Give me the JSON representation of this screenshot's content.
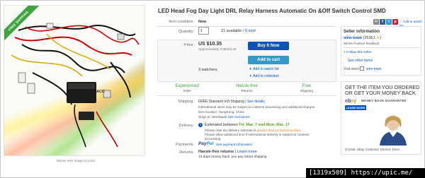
{
  "product": {
    "title": "LED Head Fog Day Light DRL Relay Harness Automatic On &Off Switch Control SMD",
    "image_ribbon": "FREE SHIPPING",
    "image_label": "ACC",
    "image_caption": "Mouse over image to zoom"
  },
  "meta": {
    "condition_label": "Item condition:",
    "condition_value": "New",
    "quantity_label": "Quantity:",
    "quantity_value": "1",
    "available_text": "21 available / ",
    "sold_text": "6 sold"
  },
  "share": {
    "icons": [
      "email-icon",
      "facebook-icon",
      "twitter-icon",
      "pinterest-icon"
    ],
    "watch_link": "Add to watch list"
  },
  "price": {
    "label": "Price:",
    "value": "US $10.35",
    "approx": "Approximately THB334.46",
    "buy_label": "Buy It Now",
    "cart_label": "Add to cart",
    "watchers": "3 watchers",
    "add_watch": "Add to watch list",
    "add_collection": "Add to collection"
  },
  "badges": [
    {
      "title": "Experienced",
      "sub": "Seller"
    },
    {
      "title": "Hassle-free",
      "sub": "Returns"
    },
    {
      "title": "Free",
      "sub": "Shipping"
    }
  ],
  "shipping": {
    "label": "Shipping:",
    "line1_main": "FREE  Standard Int'l Shipping | ",
    "line1_link": "See details",
    "line2": "International items may be subject to customs processing and additional charges.",
    "line3": "Item location:  HongKong, China",
    "line4_main": "Ships to: Worldwide ",
    "line4_link": "See exclusions"
  },
  "delivery": {
    "label": "Delivery:",
    "icon": "info-icon",
    "main": "Estimated between ",
    "dates": "Fri. Mar. 7 and Mon. Mar. 17",
    "note1_a": "Please note the delivery estimate is ",
    "note1_b": "greater than 13 business days.",
    "note2": "Please allow additional time if international delivery is subject to customs",
    "note3": "processing."
  },
  "payments": {
    "label": "Payments:",
    "paypal_a": "Pay",
    "paypal_b": "Pal",
    "link": "See payment information"
  },
  "returns": {
    "label": "Returns:",
    "main": "Hassle-free returns",
    "sep": " | ",
    "link": "Learn more",
    "sub": "14 days money back, you pay return shipping"
  },
  "seller": {
    "heading": "Seller information",
    "name": "sino-town",
    "score": " (25361 ",
    "score_end": ")",
    "feedback": "99.6% Positive feedback",
    "follow": "Follow this seller",
    "see_items": "See other items",
    "visit_label": "Visit store:",
    "store_name": "sino-town"
  },
  "ad": {
    "headline1": "GET THE ITEM YOU ORDERED",
    "headline2": "OR GET YOUR MONEY BACK",
    "logo_e": "e",
    "logo_b": "b",
    "logo_a": "a",
    "logo_y": "y",
    "guarantee": "MONEY BACK GUARANTEE",
    "learn_more": "LEARN MORE",
    "caption": "Crystal, eBay Customer Service Team"
  },
  "watermark": "[1319x509] https://upic.me/"
}
